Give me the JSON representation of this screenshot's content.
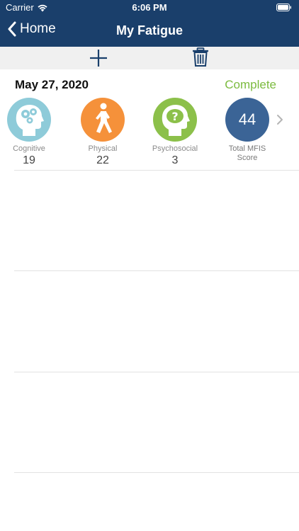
{
  "status_bar": {
    "carrier": "Carrier",
    "time": "6:06 PM"
  },
  "nav": {
    "back_label": "Home",
    "title": "My Fatigue"
  },
  "colors": {
    "header_bg": "#1a3f6b",
    "toolbar_bg": "#f0f0f0",
    "status_complete": "#7cbb3f",
    "cognitive": "#8ecbd9",
    "physical": "#f5913a",
    "psychosocial": "#8cc04a",
    "total": "#3b6496"
  },
  "entry": {
    "date": "May 27, 2020",
    "status": "Complete",
    "metrics": [
      {
        "label": "Cognitive",
        "value": "19",
        "icon": "head-gears-icon"
      },
      {
        "label": "Physical",
        "value": "22",
        "icon": "walking-person-icon"
      },
      {
        "label": "Psychosocial",
        "value": "3",
        "icon": "head-question-icon"
      }
    ],
    "total": {
      "label_line1": "Total MFIS",
      "label_line2": "Score",
      "value": "44"
    }
  }
}
